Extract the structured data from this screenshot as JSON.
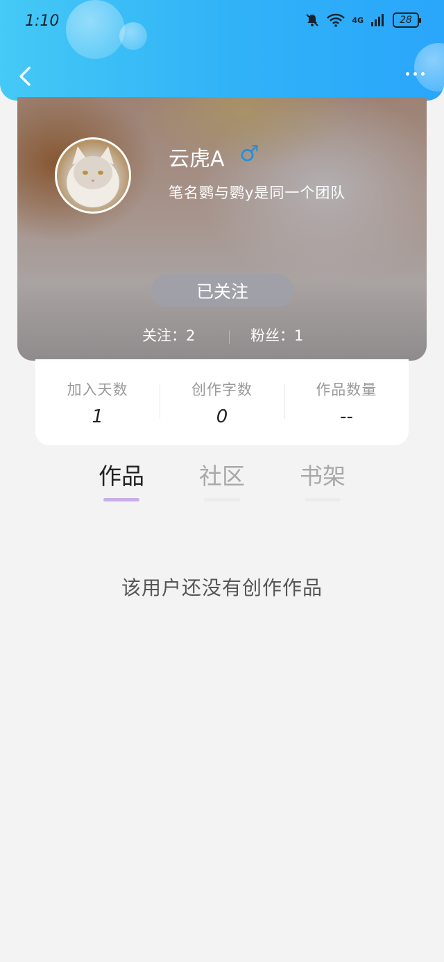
{
  "status_bar": {
    "time": "1:10",
    "network": "4G",
    "battery": "28"
  },
  "profile": {
    "username": "云虎A",
    "gender_symbol": "♂",
    "bio": "笔名鹦与鹦y是同一个团队",
    "follow_button": "已关注",
    "following": "关注：2",
    "fans": "粉丝：1"
  },
  "stats": [
    {
      "label": "加入天数",
      "value": "1"
    },
    {
      "label": "创作字数",
      "value": "0"
    },
    {
      "label": "作品数量",
      "value": "--"
    }
  ],
  "tabs": [
    {
      "label": "作品",
      "active": true
    },
    {
      "label": "社区",
      "active": false
    },
    {
      "label": "书架",
      "active": false
    }
  ],
  "empty_message": "该用户还没有创作作品",
  "colors": {
    "header_start": "#45c9f6",
    "header_end": "#2aa6fb",
    "tab_indicator": "#c9aee8",
    "gender": "#2a8ed8"
  }
}
